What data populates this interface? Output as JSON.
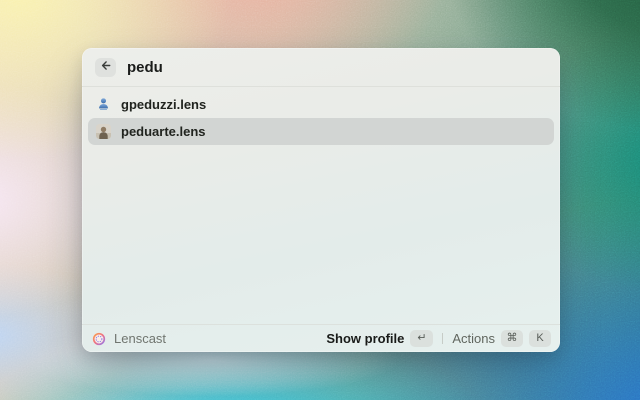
{
  "window": {
    "search": {
      "query": "pedu",
      "back_icon": "arrow-left"
    },
    "results": [
      {
        "name": "gpeduzzi.lens",
        "icon": "blue-user-silhouette",
        "selected": false
      },
      {
        "name": "peduarte.lens",
        "icon": "photo-avatar",
        "selected": true
      }
    ],
    "footer": {
      "app_name": "Lenscast",
      "app_icon": "lenscast-ring-logo",
      "primary_action": "Show profile",
      "primary_key": "↵",
      "secondary_action": "Actions",
      "secondary_keys": [
        "⌘",
        "K"
      ]
    }
  },
  "colors": {
    "selection_bg": "#d2d5d3",
    "avatar_accent": "#4e82c4",
    "logo_gradient": [
      "#F7A44C",
      "#EE6F86",
      "#8F7BEF"
    ],
    "wallpaper_corners": {
      "top_left": "#faf2ae",
      "top_right": "#1d5a3a",
      "bottom_left": "#14c9ee",
      "bottom_right": "#2a72da"
    }
  }
}
